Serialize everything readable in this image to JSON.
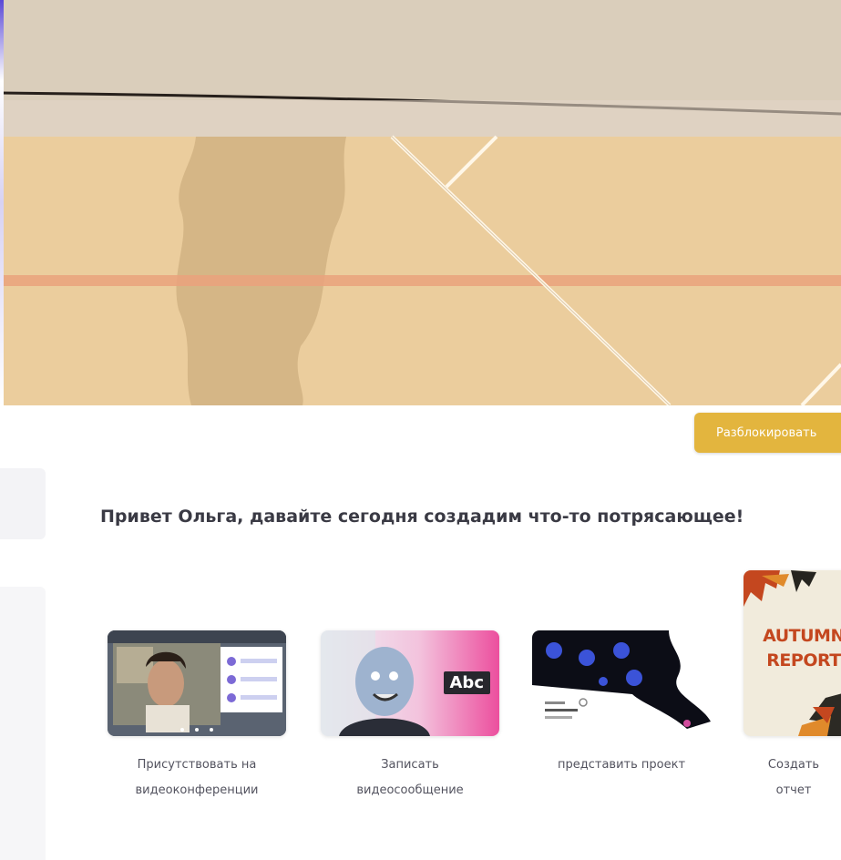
{
  "header": {
    "unlock_button": "Разблокировать"
  },
  "main": {
    "greeting": "Привет Ольга, давайте сегодня создадим что-то потрясающее!",
    "templates": [
      {
        "label_line1": "Присутствовать на",
        "label_line2": "видеоконференции",
        "icon": "video-conference-thumbnail"
      },
      {
        "label_line1": "Записать",
        "label_line2": "видеосообщение",
        "icon": "video-message-thumbnail",
        "badge": "Abc"
      },
      {
        "label_line1": "представить проект",
        "label_line2": "",
        "icon": "project-presentation-thumbnail"
      },
      {
        "label_line1": "Создать",
        "label_line2": "отчет",
        "icon": "report-thumbnail",
        "title1": "AUTUMN",
        "title2": "REPORT"
      }
    ]
  },
  "colors": {
    "accent_button": "#e3b53e",
    "photo_sand": "#e9cca0",
    "photo_wall": "#ddd0bf",
    "stripe": "#e9a47e"
  }
}
